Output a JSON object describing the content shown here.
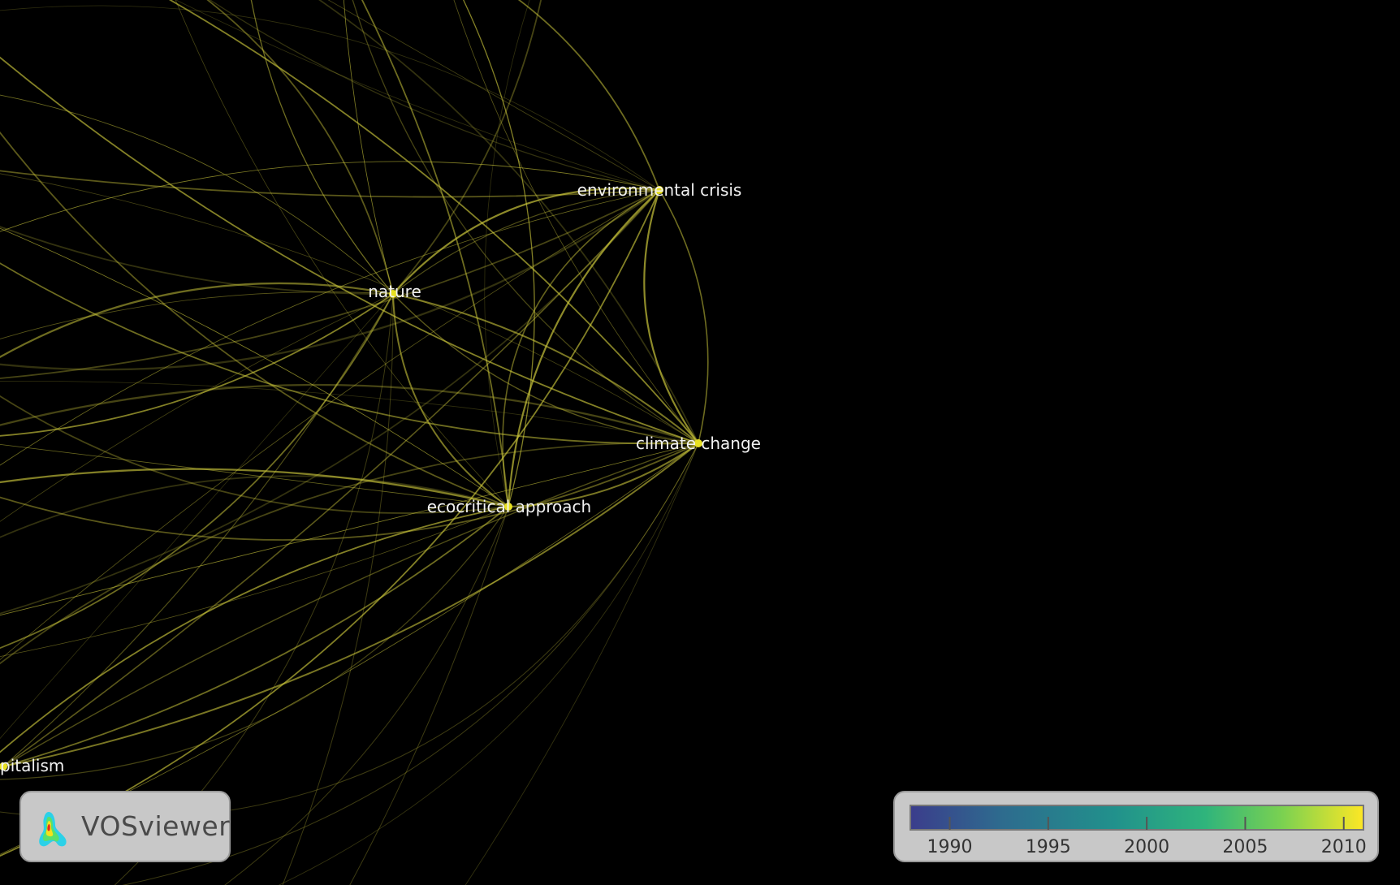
{
  "nodes": [
    {
      "id": "environmental-crisis",
      "label": "environmental crisis"
    },
    {
      "id": "nature",
      "label": "nature"
    },
    {
      "id": "climate-change",
      "label": "climate change"
    },
    {
      "id": "ecocritical-approach",
      "label": "ecocritical approach"
    },
    {
      "id": "capitalism",
      "label": "pitalism"
    }
  ],
  "colors": {
    "background": "#000000",
    "link": "#c9c43a",
    "node": "#e8e020",
    "label": "#f2f2f2",
    "panel": "#c8c8c8"
  },
  "brand": {
    "name": "VOSviewer",
    "icon": "vosviewer-logo-icon"
  },
  "legend": {
    "ticks": [
      "1990",
      "1995",
      "2000",
      "2005",
      "2010"
    ],
    "range": [
      1988,
      2011
    ],
    "gradient": [
      "#3b3d8c",
      "#2e6b8e",
      "#21918c",
      "#2fb47c",
      "#7ad151",
      "#fde725"
    ]
  }
}
